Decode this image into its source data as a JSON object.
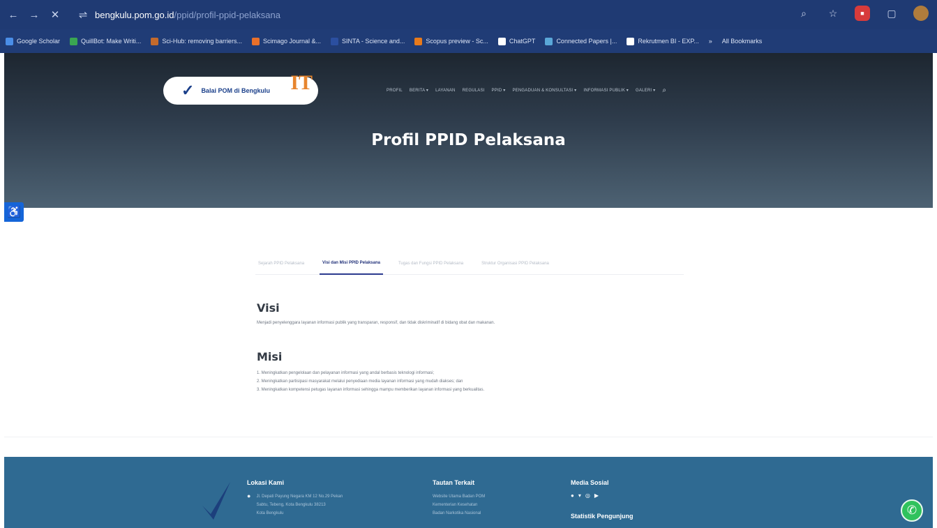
{
  "browser": {
    "url_host": "bengkulu.pom.go.id",
    "url_path": "/ppid/profil-ppid-pelaksana",
    "bookmarks": [
      {
        "label": "Google Scholar",
        "color": "#4a8ee8"
      },
      {
        "label": "QuillBot: Make Writi...",
        "color": "#3aa652"
      },
      {
        "label": "Sci-Hub: removing barriers...",
        "color": "#c46a2c"
      },
      {
        "label": "Scimago Journal &...",
        "color": "#e8702b"
      },
      {
        "label": "SINTA - Science and...",
        "color": "#2b4fa0"
      },
      {
        "label": "Scopus preview - Sc...",
        "color": "#e87a1b"
      },
      {
        "label": "ChatGPT",
        "color": "#ffffff"
      },
      {
        "label": "Connected Papers |...",
        "color": "#5aa7d8"
      },
      {
        "label": "Rekrutmen BI - EXP...",
        "color": "#ffffff"
      },
      {
        "label": "»",
        "color": ""
      },
      {
        "label": "All Bookmarks",
        "color": ""
      }
    ]
  },
  "site": {
    "logo_text": "Balai POM di Bengkulu",
    "nav": [
      "PROFIL",
      "BERITA ▾",
      "LAYANAN",
      "REGULASI",
      "PPID ▾",
      "PENGADUAN & KONSULTASI ▾",
      "INFORMASI PUBLIK ▾",
      "GALERI ▾"
    ],
    "page_title": "Profil PPID Pelaksana"
  },
  "tabs": [
    {
      "label": "Sejarah PPID Pelaksana",
      "active": false
    },
    {
      "label": "Visi dan Misi PPID Pelaksana",
      "active": true
    },
    {
      "label": "Tugas dan Fungsi PPID Pelaksana",
      "active": false
    },
    {
      "label": "Struktur Organisasi PPID Pelaksana",
      "active": false
    }
  ],
  "visi": {
    "title": "Visi",
    "text": "Menjadi penyelenggara layanan informasi publik yang transparan, responsif, dan tidak diskriminatif di bidang obat dan makanan."
  },
  "misi": {
    "title": "Misi",
    "items": [
      "1. Meningkatkan pengelolaan dan pelayanan informasi yang andal berbasis teknologi informasi;",
      "2. Meningkatkan partisipasi masyarakat melalui penyediaan media layanan informasi yang mudah diakses; dan",
      "3. Meningkatkan kompetensi petugas layanan informasi sehingga mampu memberikan layanan informasi yang berkualitas."
    ]
  },
  "footer": {
    "location_title": "Lokasi Kami",
    "location_lines": [
      "Jl. Depati Payung Negara KM 12 No.29 Pekan",
      "Sabtu, Tebeng, Kota Bengkulu 38213",
      "Kota Bengkulu"
    ],
    "links_title": "Tautan Terkait",
    "links": [
      "Website Utama Badan POM",
      "Kementerian Kesehatan",
      "Badan Narkotika Nasional"
    ],
    "social_title": "Media Sosial",
    "visitor_title": "Statistik Pengunjung"
  }
}
